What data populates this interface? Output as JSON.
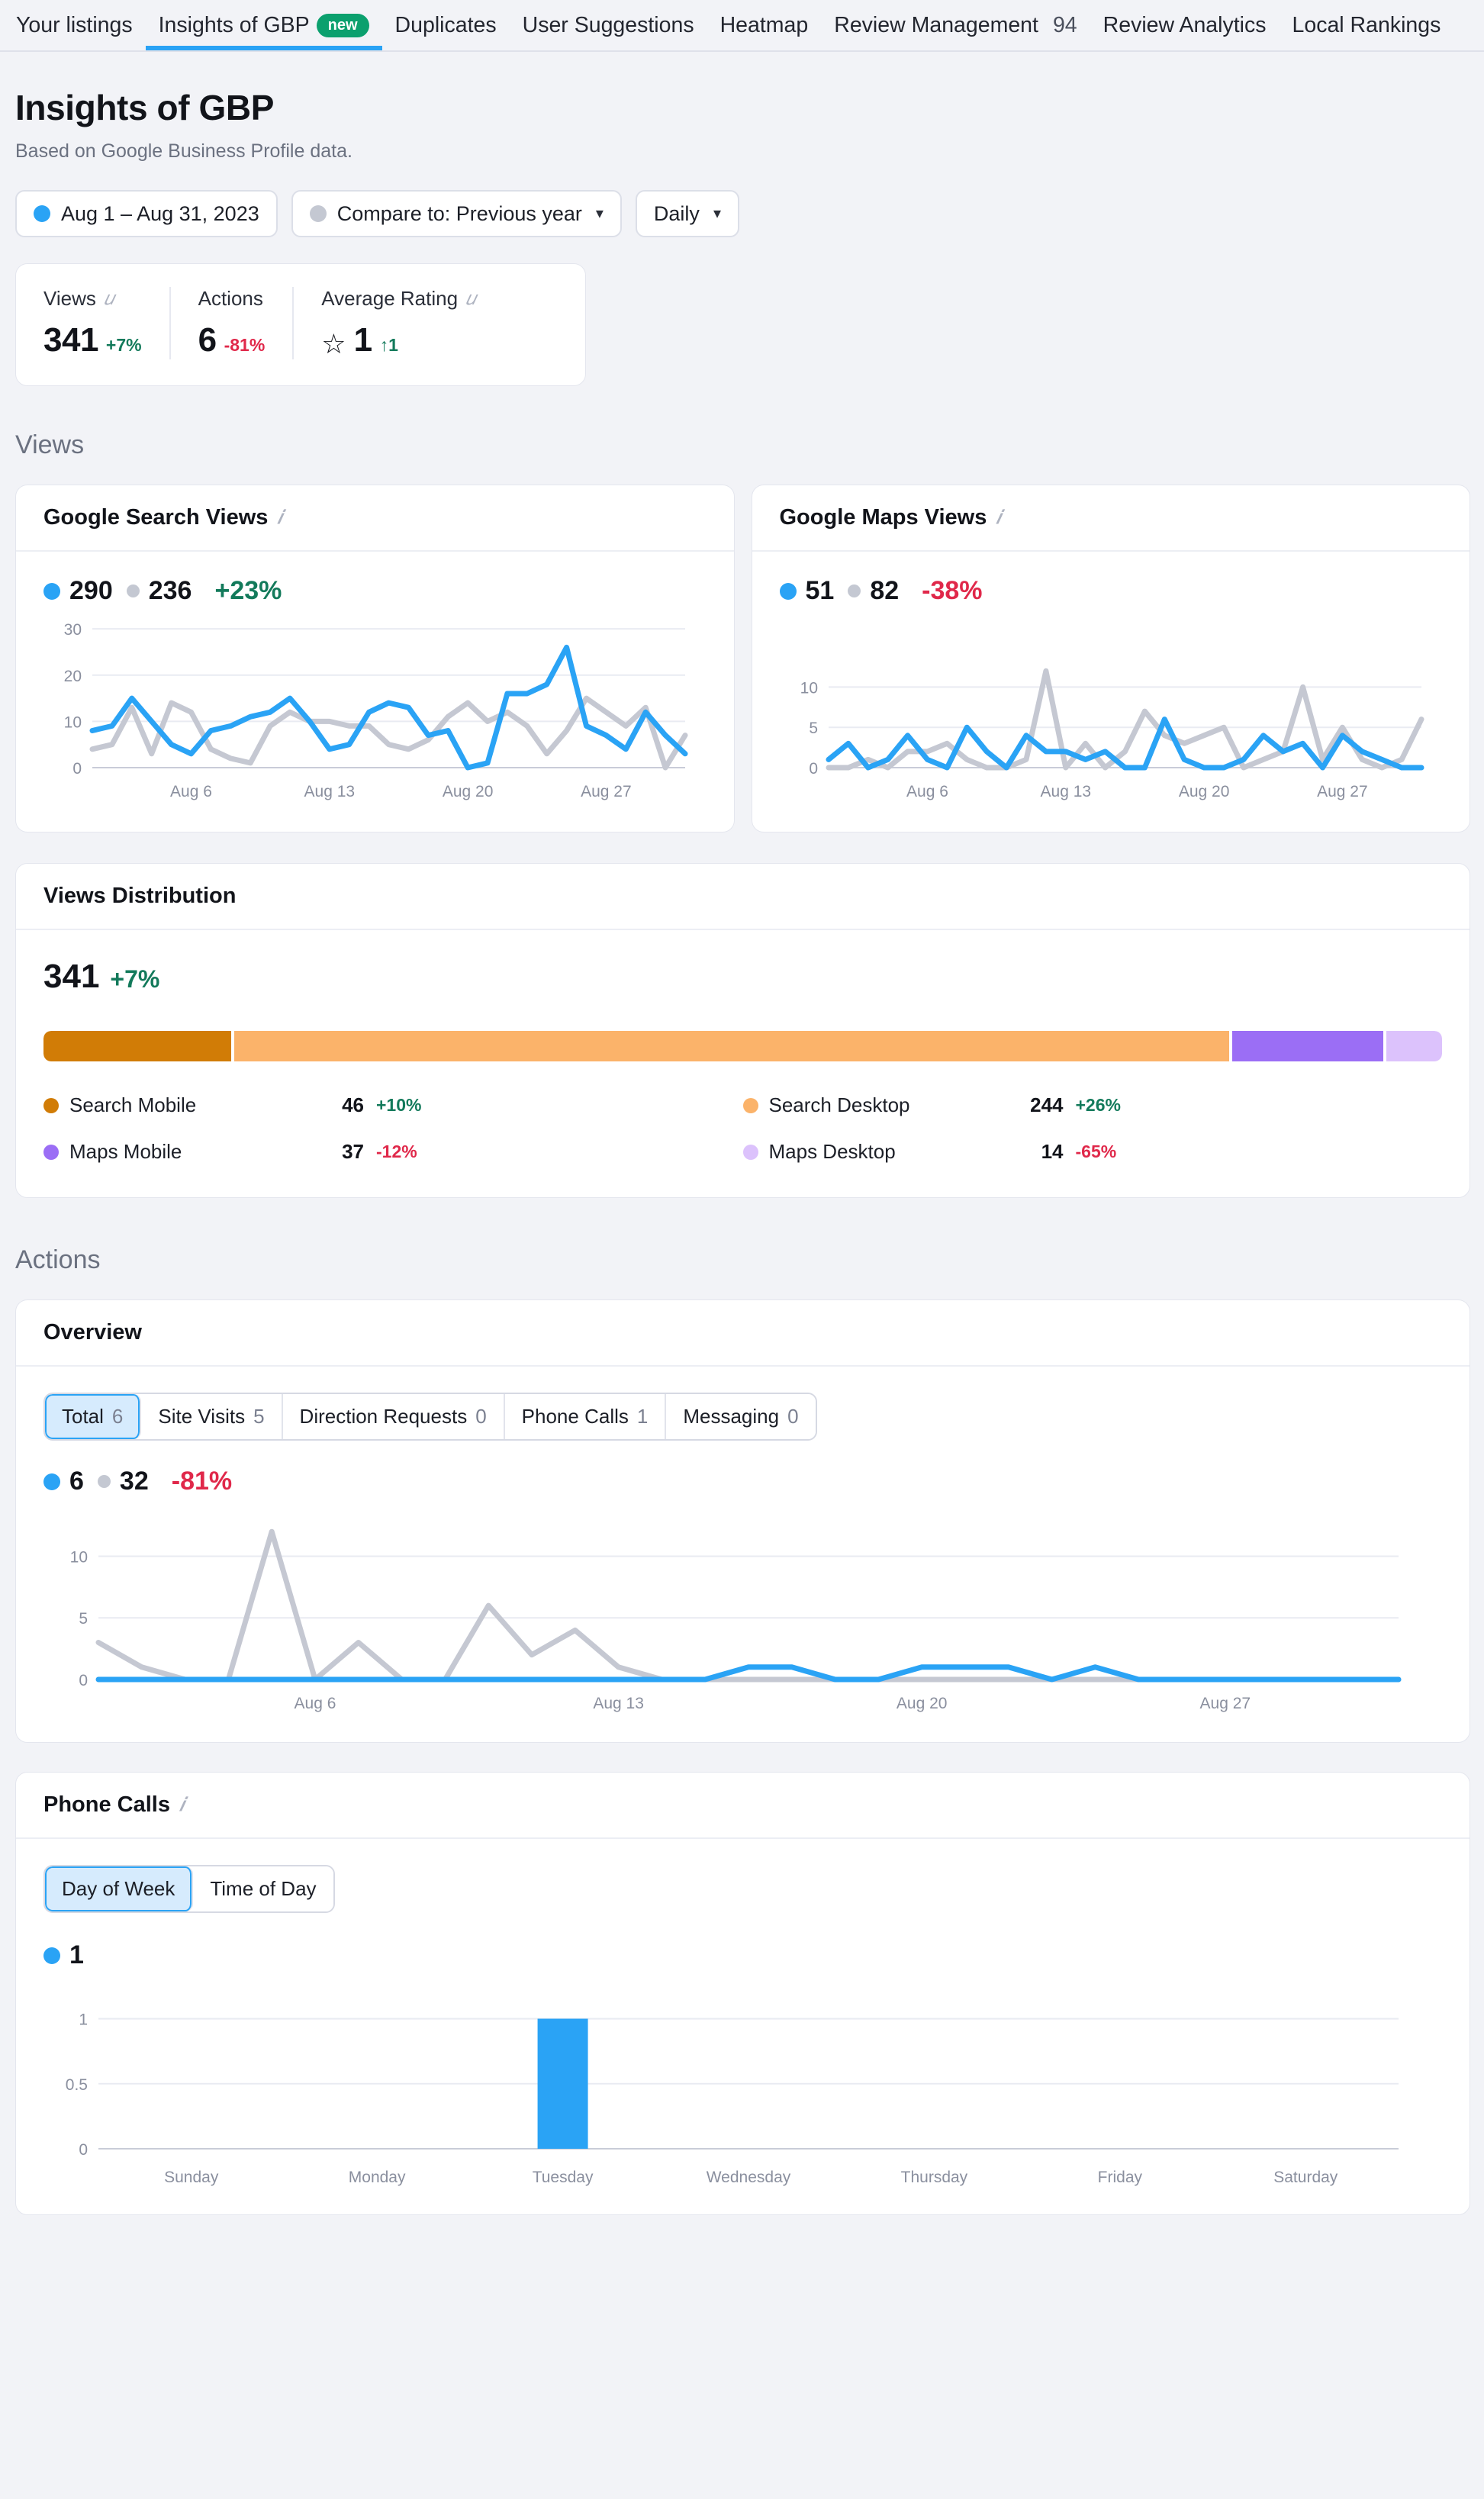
{
  "nav": {
    "items": [
      {
        "label": "Your listings",
        "active": false,
        "badge": null,
        "count": null
      },
      {
        "label": "Insights of GBP",
        "active": true,
        "badge": "new",
        "count": null
      },
      {
        "label": "Duplicates",
        "active": false,
        "badge": null,
        "count": null
      },
      {
        "label": "User Suggestions",
        "active": false,
        "badge": null,
        "count": null
      },
      {
        "label": "Heatmap",
        "active": false,
        "badge": null,
        "count": null
      },
      {
        "label": "Review Management",
        "active": false,
        "badge": null,
        "count": "94"
      },
      {
        "label": "Review Analytics",
        "active": false,
        "badge": null,
        "count": null
      },
      {
        "label": "Local Rankings",
        "active": false,
        "badge": null,
        "count": null
      }
    ]
  },
  "header": {
    "title": "Insights of GBP",
    "subtitle": "Based on Google Business Profile data."
  },
  "filters": {
    "date_range": "Aug 1 – Aug 31, 2023",
    "compare": "Compare to: Previous year",
    "granularity": "Daily",
    "caret": "⌄"
  },
  "kpis": [
    {
      "label": "Views",
      "value": "341",
      "delta": "+7%",
      "dir": "up",
      "has_info": true,
      "icon": null
    },
    {
      "label": "Actions",
      "value": "6",
      "delta": "-81%",
      "dir": "down",
      "has_info": false,
      "icon": null
    },
    {
      "label": "Average Rating",
      "value": "1",
      "delta": "↑1",
      "dir": "up",
      "has_info": true,
      "icon": "star-icon"
    }
  ],
  "sections": {
    "views": "Views",
    "actions": "Actions"
  },
  "colors": {
    "current": "#2aa3f5",
    "previous": "#c5c8d2",
    "up": "#137a5b",
    "down": "#f04a5e",
    "search_mobile": "#d17c06",
    "search_desktop": "#fbb36a",
    "maps_mobile": "#9b6ef5",
    "maps_desktop": "#dcc2fc",
    "badge_new": "#0ba06e"
  },
  "search_views_card": {
    "title": "Google Search Views",
    "current": "290",
    "previous": "236",
    "change": "+23%",
    "change_dir": "up"
  },
  "maps_views_card": {
    "title": "Google Maps Views",
    "current": "51",
    "previous": "82",
    "change": "-38%",
    "change_dir": "down"
  },
  "views_distribution": {
    "title": "Views Distribution",
    "total": "341",
    "change": "+7%",
    "change_dir": "up",
    "items": [
      {
        "name": "Search Mobile",
        "value": "46",
        "delta": "+10%",
        "dir": "up",
        "color": "#d17c06",
        "share": 13.5
      },
      {
        "name": "Search Desktop",
        "value": "244",
        "delta": "+26%",
        "dir": "up",
        "color": "#fbb36a",
        "share": 71.6
      },
      {
        "name": "Maps Mobile",
        "value": "37",
        "delta": "-12%",
        "dir": "down",
        "color": "#9b6ef5",
        "share": 10.9
      },
      {
        "name": "Maps Desktop",
        "value": "14",
        "delta": "-65%",
        "dir": "down",
        "color": "#dcc2fc",
        "share": 4.0
      }
    ]
  },
  "overview_card": {
    "title": "Overview",
    "tabs": [
      {
        "label": "Total",
        "count": "6",
        "selected": true
      },
      {
        "label": "Site Visits",
        "count": "5",
        "selected": false
      },
      {
        "label": "Direction Requests",
        "count": "0",
        "selected": false
      },
      {
        "label": "Phone Calls",
        "count": "1",
        "selected": false
      },
      {
        "label": "Messaging",
        "count": "0",
        "selected": false
      }
    ],
    "current": "6",
    "previous": "32",
    "change": "-81%",
    "change_dir": "down"
  },
  "phone_calls_card": {
    "title": "Phone Calls",
    "tabs": [
      {
        "label": "Day of Week",
        "selected": true
      },
      {
        "label": "Time of Day",
        "selected": false
      }
    ],
    "current": "1"
  },
  "chart_data": [
    {
      "id": "google_search_views",
      "type": "line",
      "title": "Google Search Views",
      "xlabel": "",
      "ylabel": "",
      "ylim": [
        0,
        32
      ],
      "yticks": [
        0,
        10,
        20,
        30
      ],
      "xticks": [
        "Aug 6",
        "Aug 13",
        "Aug 20",
        "Aug 27"
      ],
      "xtick_index": [
        5,
        12,
        19,
        26
      ],
      "grid": true,
      "legend": [
        "290",
        "236"
      ],
      "x": [
        "Aug 1",
        "Aug 2",
        "Aug 3",
        "Aug 4",
        "Aug 5",
        "Aug 6",
        "Aug 7",
        "Aug 8",
        "Aug 9",
        "Aug 10",
        "Aug 11",
        "Aug 12",
        "Aug 13",
        "Aug 14",
        "Aug 15",
        "Aug 16",
        "Aug 17",
        "Aug 18",
        "Aug 19",
        "Aug 20",
        "Aug 21",
        "Aug 22",
        "Aug 23",
        "Aug 24",
        "Aug 25",
        "Aug 26",
        "Aug 27",
        "Aug 28",
        "Aug 29",
        "Aug 30",
        "Aug 31"
      ],
      "series": [
        {
          "name": "Current period",
          "color": "#2aa3f5",
          "values": [
            8,
            9,
            15,
            10,
            5,
            3,
            8,
            9,
            11,
            12,
            15,
            10,
            4,
            5,
            12,
            14,
            13,
            7,
            8,
            0,
            1,
            16,
            16,
            18,
            26,
            9,
            7,
            4,
            12,
            7,
            3
          ]
        },
        {
          "name": "Previous year",
          "color": "#c5c8d2",
          "values": [
            4,
            5,
            13,
            3,
            14,
            12,
            4,
            2,
            1,
            9,
            12,
            10,
            10,
            9,
            9,
            5,
            4,
            6,
            11,
            14,
            10,
            12,
            9,
            3,
            8,
            15,
            12,
            9,
            13,
            0,
            7
          ]
        }
      ]
    },
    {
      "id": "google_maps_views",
      "type": "line",
      "title": "Google Maps Views",
      "xlabel": "",
      "ylabel": "",
      "ylim": [
        0,
        12.5
      ],
      "yticks": [
        0,
        5,
        10
      ],
      "xticks": [
        "Aug 6",
        "Aug 13",
        "Aug 20",
        "Aug 27"
      ],
      "xtick_index": [
        5,
        12,
        19,
        26
      ],
      "grid": true,
      "legend": [
        "51",
        "82"
      ],
      "x": [
        "Aug 1",
        "Aug 2",
        "Aug 3",
        "Aug 4",
        "Aug 5",
        "Aug 6",
        "Aug 7",
        "Aug 8",
        "Aug 9",
        "Aug 10",
        "Aug 11",
        "Aug 12",
        "Aug 13",
        "Aug 14",
        "Aug 15",
        "Aug 16",
        "Aug 17",
        "Aug 18",
        "Aug 19",
        "Aug 20",
        "Aug 21",
        "Aug 22",
        "Aug 23",
        "Aug 24",
        "Aug 25",
        "Aug 26",
        "Aug 27",
        "Aug 28",
        "Aug 29",
        "Aug 30",
        "Aug 31"
      ],
      "series": [
        {
          "name": "Current period",
          "color": "#2aa3f5",
          "values": [
            1,
            3,
            0,
            1,
            4,
            1,
            0,
            5,
            2,
            0,
            4,
            2,
            2,
            1,
            2,
            0,
            0,
            6,
            1,
            0,
            0,
            1,
            4,
            2,
            3,
            0,
            4,
            2,
            1,
            0,
            0
          ]
        },
        {
          "name": "Previous year",
          "color": "#c5c8d2",
          "values": [
            0,
            0,
            1,
            0,
            2,
            2,
            3,
            1,
            0,
            0,
            1,
            12,
            0,
            3,
            0,
            2,
            7,
            4,
            3,
            4,
            5,
            0,
            1,
            2,
            10,
            1,
            5,
            1,
            0,
            1,
            6
          ]
        }
      ]
    },
    {
      "id": "actions_overview",
      "type": "line",
      "title": "Overview",
      "xlabel": "",
      "ylabel": "",
      "ylim": [
        0,
        13
      ],
      "yticks": [
        0,
        5,
        10
      ],
      "xticks": [
        "Aug 6",
        "Aug 13",
        "Aug 20",
        "Aug 27"
      ],
      "xtick_index": [
        5,
        12,
        19,
        26
      ],
      "grid": true,
      "legend": [
        "6",
        "32"
      ],
      "x": [
        "Aug 1",
        "Aug 2",
        "Aug 3",
        "Aug 4",
        "Aug 5",
        "Aug 6",
        "Aug 7",
        "Aug 8",
        "Aug 9",
        "Aug 10",
        "Aug 11",
        "Aug 12",
        "Aug 13",
        "Aug 14",
        "Aug 15",
        "Aug 16",
        "Aug 17",
        "Aug 18",
        "Aug 19",
        "Aug 20",
        "Aug 21",
        "Aug 22",
        "Aug 23",
        "Aug 24",
        "Aug 25",
        "Aug 26",
        "Aug 27",
        "Aug 28",
        "Aug 29",
        "Aug 30",
        "Aug 31"
      ],
      "series": [
        {
          "name": "Current period",
          "color": "#2aa3f5",
          "values": [
            0,
            0,
            0,
            0,
            0,
            0,
            0,
            0,
            0,
            0,
            0,
            0,
            0,
            0,
            0,
            1,
            1,
            0,
            0,
            1,
            1,
            1,
            0,
            1,
            0,
            0,
            0,
            0,
            0,
            0,
            0
          ]
        },
        {
          "name": "Previous year",
          "color": "#c5c8d2",
          "values": [
            3,
            1,
            0,
            0,
            12,
            0,
            3,
            0,
            0,
            6,
            2,
            4,
            1,
            0,
            0,
            0,
            0,
            0,
            0,
            0,
            0,
            0,
            0,
            0,
            0,
            0,
            0,
            0,
            0,
            0,
            0
          ]
        }
      ]
    },
    {
      "id": "phone_calls_day_of_week",
      "type": "bar",
      "title": "Phone Calls",
      "xlabel": "",
      "ylabel": "",
      "ylim": [
        0,
        1.15
      ],
      "yticks": [
        0,
        0.5,
        1
      ],
      "ytick_labels": [
        "0",
        "0.5",
        "1"
      ],
      "grid": true,
      "categories": [
        "Sunday",
        "Monday",
        "Tuesday",
        "Wednesday",
        "Thursday",
        "Friday",
        "Saturday"
      ],
      "values": [
        0,
        0,
        1,
        0,
        0,
        0,
        0
      ],
      "color": "#2aa3f5"
    }
  ]
}
